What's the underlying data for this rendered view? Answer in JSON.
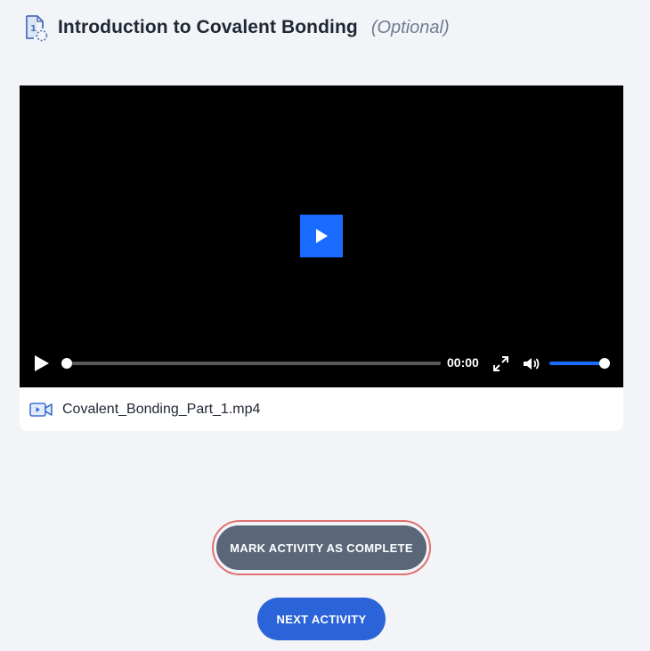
{
  "header": {
    "icon": "document-number-icon",
    "title": "Introduction to Covalent Bonding",
    "optional_label": "(Optional)"
  },
  "video": {
    "time": "00:00",
    "progress_fraction": 0,
    "volume_fraction": 1,
    "file_name": "Covalent_Bonding_Part_1.mp4",
    "accent_color": "#1a6bff"
  },
  "actions": {
    "mark_complete_label": "MARK ACTIVITY AS COMPLETE",
    "next_activity_label": "NEXT ACTIVITY"
  }
}
